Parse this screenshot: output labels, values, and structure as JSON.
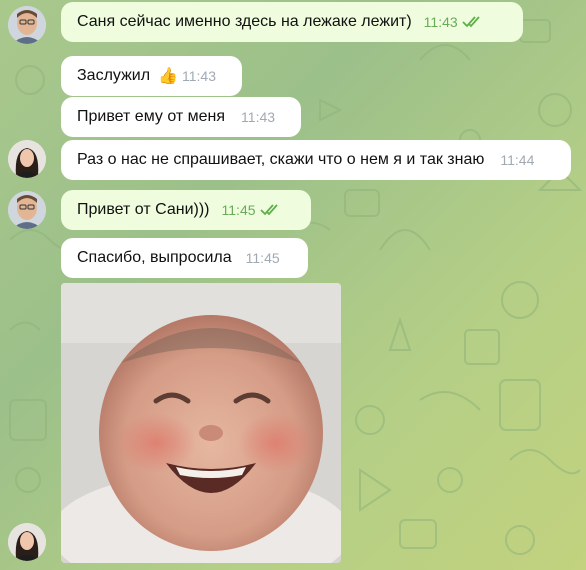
{
  "chat": {
    "messages": [
      {
        "text": "Саня сейчас именно здесь на лежаке лежит)",
        "time": "11:43",
        "status": "read"
      },
      {
        "text": "Заслужил",
        "time": "11:43",
        "reaction": "👍"
      },
      {
        "text": "Привет ему от меня",
        "time": "11:43"
      },
      {
        "text": "Раз о нас не спрашивает, скажи что о нем я и так знаю",
        "time": "11:44"
      },
      {
        "text": "Привет от Сани)))",
        "time": "11:45",
        "status": "read"
      },
      {
        "text": "Спасибо, выпросила",
        "time": "11:45"
      }
    ],
    "media_caption": ""
  },
  "colors": {
    "incoming_bubble": "#ffffff",
    "outgoing_bubble": "#effdde",
    "read_checks": "#5fae4a",
    "timestamp_in": "#a1aab3",
    "timestamp_out": "#6aab59"
  },
  "icons": {
    "read_status": "double-check-icon",
    "reaction": "thumbs-up-icon"
  }
}
